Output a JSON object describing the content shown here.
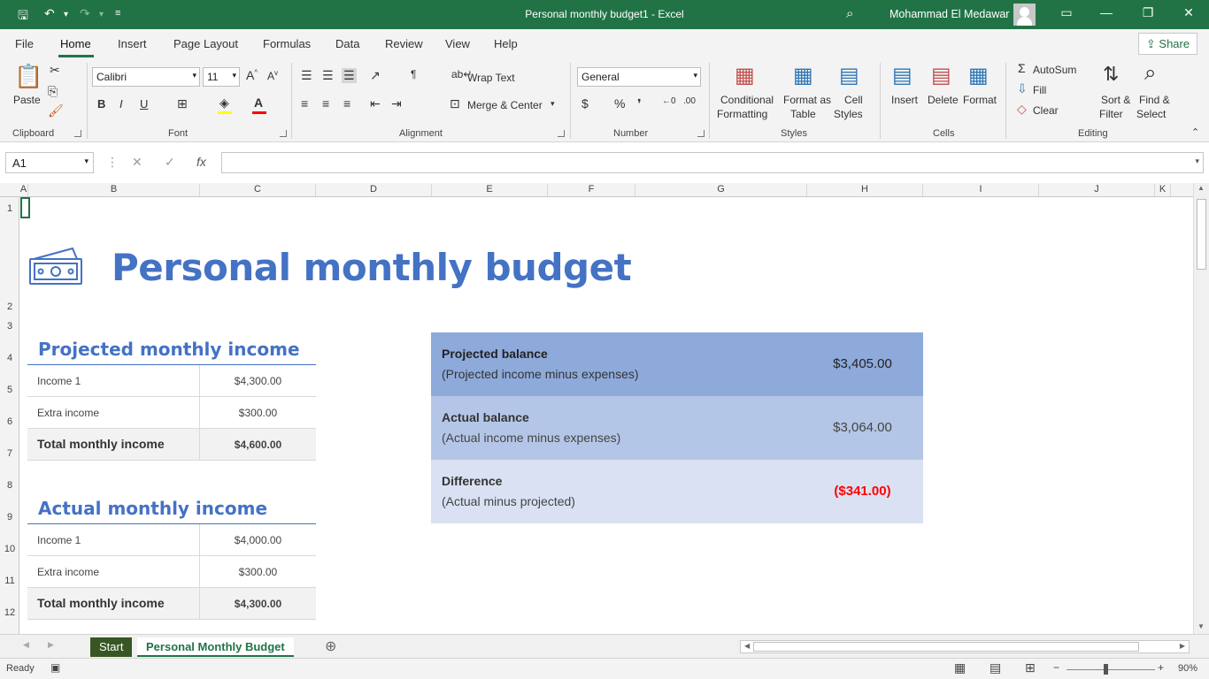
{
  "window": {
    "title": "Personal monthly budget1  -  Excel",
    "user": "Mohammad El Medawar"
  },
  "tabs": [
    "File",
    "Home",
    "Insert",
    "Page Layout",
    "Formulas",
    "Data",
    "Review",
    "View",
    "Help"
  ],
  "active_tab": "Home",
  "share_label": "Share",
  "ribbon": {
    "clipboard": {
      "paste": "Paste",
      "label": "Clipboard"
    },
    "font": {
      "name": "Calibri",
      "size": "11",
      "bold": "B",
      "italic": "I",
      "underline": "U",
      "label": "Font"
    },
    "alignment": {
      "wrap": "Wrap Text",
      "merge": "Merge & Center",
      "label": "Alignment"
    },
    "number": {
      "format": "General",
      "label": "Number"
    },
    "styles": {
      "conditional_1": "Conditional",
      "conditional_2": "Formatting",
      "format_as_1": "Format as",
      "format_as_2": "Table",
      "cell_styles_1": "Cell",
      "cell_styles_2": "Styles",
      "label": "Styles"
    },
    "cells": {
      "insert": "Insert",
      "delete": "Delete",
      "format": "Format",
      "label": "Cells"
    },
    "editing": {
      "autosum": "AutoSum",
      "fill": "Fill",
      "clear": "Clear",
      "sort_1": "Sort &",
      "sort_2": "Filter",
      "find_1": "Find &",
      "find_2": "Select",
      "label": "Editing"
    }
  },
  "formula_bar": {
    "name_box": "A1",
    "fx": "fx",
    "value": ""
  },
  "columns": [
    "A",
    "B",
    "C",
    "D",
    "E",
    "F",
    "G",
    "H",
    "I",
    "J",
    "K"
  ],
  "rows": [
    "1",
    "2",
    "3",
    "4",
    "5",
    "6",
    "7",
    "8",
    "9",
    "10",
    "11",
    "12"
  ],
  "sheet": {
    "title": "Personal monthly budget",
    "projected_income": {
      "heading": "Projected monthly income",
      "rows": [
        {
          "label": "Income 1",
          "value": "$4,300.00"
        },
        {
          "label": "Extra income",
          "value": "$300.00"
        }
      ],
      "total": {
        "label": "Total monthly income",
        "value": "$4,600.00"
      }
    },
    "actual_income": {
      "heading": "Actual monthly income",
      "rows": [
        {
          "label": "Income 1",
          "value": "$4,000.00"
        },
        {
          "label": "Extra income",
          "value": "$300.00"
        }
      ],
      "total": {
        "label": "Total monthly income",
        "value": "$4,300.00"
      }
    },
    "balances": [
      {
        "title": "Projected balance",
        "subtitle": "(Projected income minus expenses)",
        "value": "$3,405.00",
        "color": "#8eaadb"
      },
      {
        "title": "Actual balance",
        "subtitle": "(Actual income minus expenses)",
        "value": "$3,064.00",
        "color": "#b4c6e7"
      },
      {
        "title": "Difference",
        "subtitle": "(Actual minus projected)",
        "value": "($341.00)",
        "color": "#d9e1f2"
      }
    ]
  },
  "sheet_tabs": [
    "Start",
    "Personal Monthly Budget"
  ],
  "status": {
    "ready": "Ready",
    "zoom": "90%"
  },
  "colors": {
    "accent": "#217346",
    "title_blue": "#4472c4",
    "negative": "#ff0000"
  }
}
